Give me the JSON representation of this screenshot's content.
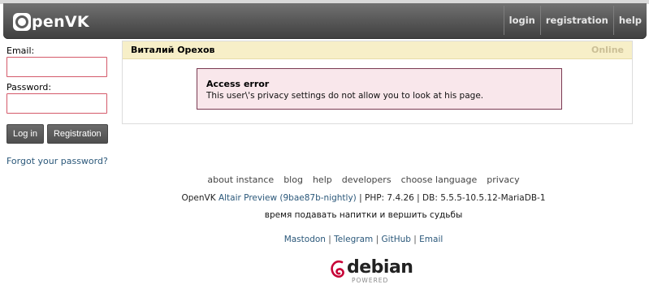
{
  "header": {
    "logo_text": "penVK",
    "nav": [
      "login",
      "registration",
      "help"
    ]
  },
  "sidebar": {
    "email_label": "Email:",
    "password_label": "Password:",
    "login_button": "Log in",
    "registration_button": "Registration",
    "forgot_link": "Forgot your password?"
  },
  "profile": {
    "name": "Виталий Орехов",
    "status": "Online",
    "error_title": "Access error",
    "error_text": "This user\\'s privacy settings do not allow you to look at his page."
  },
  "footer": {
    "links": [
      "about instance",
      "blog",
      "help",
      "developers",
      "choose language",
      "privacy"
    ],
    "version_prefix": "OpenVK",
    "version_link": "Altair Preview (9bae87b-nightly)",
    "version_suffix": "| PHP: 7.4.26 | DB: 5.5.5-10.5.12-MariaDB-1",
    "motto": "время подавать напитки и вершить судьбы",
    "social": [
      "Mastodon",
      "Telegram",
      "GitHub",
      "Email"
    ],
    "social_sep": "|",
    "debian_word": "debian",
    "debian_powered": "POWERED"
  },
  "colors": {
    "header_dark": "#3f3f3f",
    "link_blue": "#2b587a",
    "field_border": "#d45a6a",
    "profile_head_bg": "#f7efc8",
    "error_bg": "#f9e7eb",
    "error_border": "#7a3a52",
    "debian_swirl": "#c70036"
  }
}
